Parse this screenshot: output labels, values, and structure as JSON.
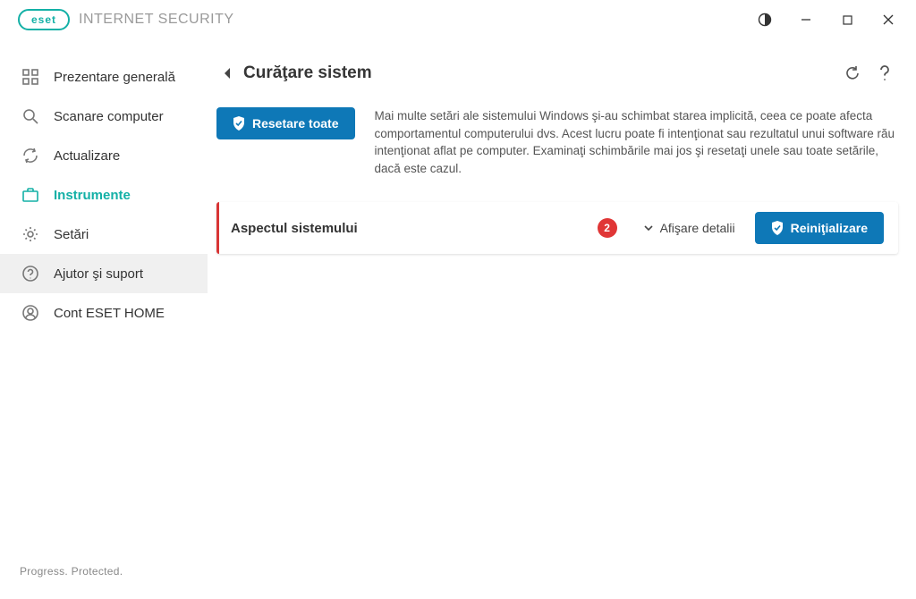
{
  "product": {
    "brand": "eset",
    "name": "INTERNET SECURITY"
  },
  "sidebar": {
    "items": [
      {
        "label": "Prezentare generală"
      },
      {
        "label": "Scanare computer"
      },
      {
        "label": "Actualizare"
      },
      {
        "label": "Instrumente"
      },
      {
        "label": "Setări"
      },
      {
        "label": "Ajutor şi suport"
      },
      {
        "label": "Cont ESET HOME"
      }
    ],
    "footer": "Progress. Protected."
  },
  "page": {
    "title": "Curăţare sistem",
    "reset_all": "Resetare toate",
    "intro": "Mai multe setări ale sistemului Windows şi-au schimbat starea implicită, ceea ce poate afecta comportamentul computerului dvs. Acest lucru poate fi intenţionat sau rezultatul unui software rău intenţionat aflat pe computer. Examinaţi schimbările mai jos şi resetaţi unele sau toate setările, dacă este cazul.",
    "card": {
      "title": "Aspectul sistemului",
      "count": "2",
      "details_label": "Afişare detalii",
      "reset_label": "Reiniţializare"
    }
  }
}
